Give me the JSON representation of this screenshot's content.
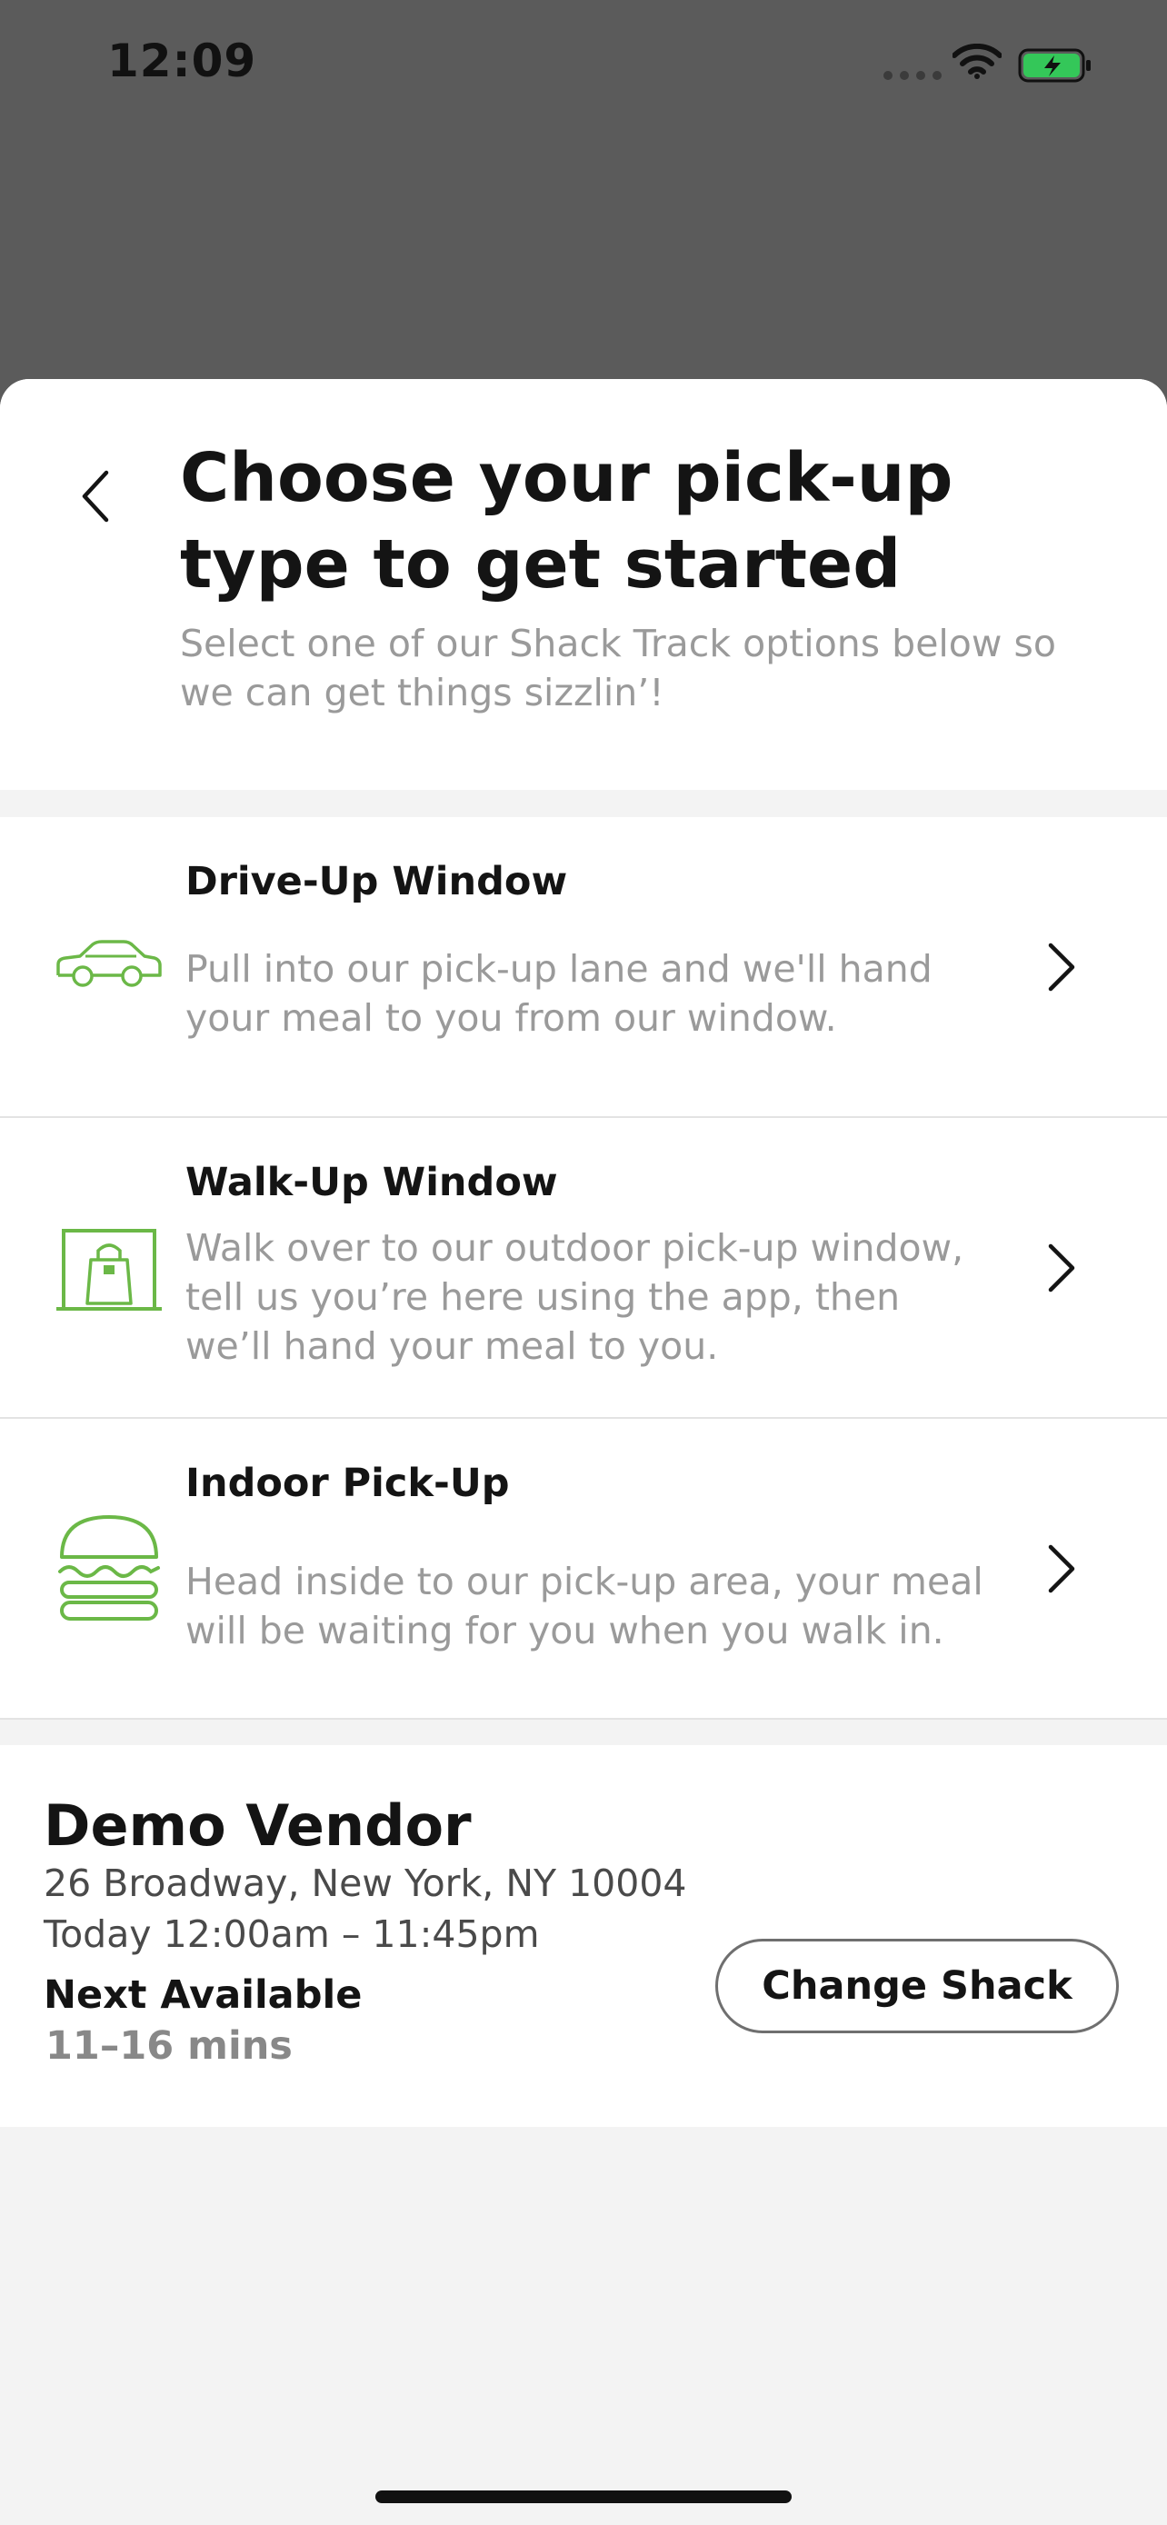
{
  "status_bar": {
    "time": "12:09"
  },
  "header": {
    "title": "Choose your pick-up type to get started",
    "subtitle": "Select one of our Shack Track options below so we can get things sizzlin’!"
  },
  "options": [
    {
      "title": "Drive-Up Window",
      "description": "Pull into our pick-up lane and we'll hand your meal to you from our window.",
      "icon": "car-icon"
    },
    {
      "title": "Walk-Up Window",
      "description": "Walk over to our outdoor pick-up window, tell us you’re here using the app, then we’ll hand your meal to you.",
      "icon": "walk-up-window-icon"
    },
    {
      "title": "Indoor Pick-Up",
      "description": "Head inside to our pick-up area, your meal will be waiting for you when you walk in.",
      "icon": "burger-icon"
    }
  ],
  "vendor": {
    "name": "Demo Vendor",
    "address": "26 Broadway, New York, NY 10004",
    "hours": "Today 12:00am – 11:45pm",
    "next_label": "Next Available",
    "next_time": "11–16 mins",
    "change_button": "Change Shack"
  },
  "colors": {
    "accent": "#6bb847",
    "text": "#141414",
    "muted": "#9a9a9a"
  }
}
